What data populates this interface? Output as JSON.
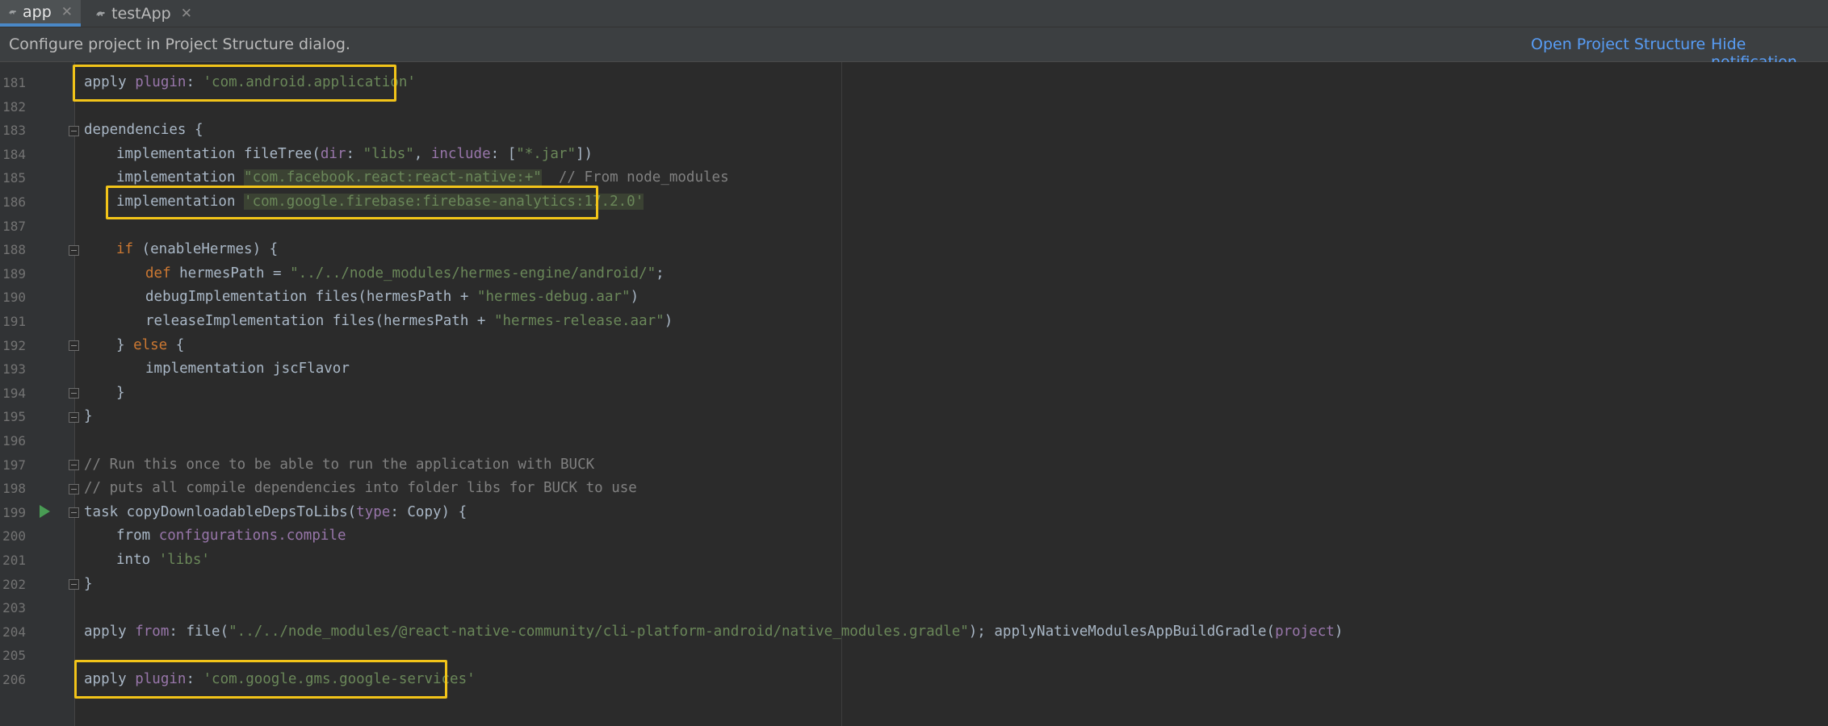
{
  "tabs": [
    {
      "label": "app",
      "icon": "gradle-icon",
      "active": true
    },
    {
      "label": "testApp",
      "icon": "gradle-icon",
      "active": false
    }
  ],
  "notification": {
    "message": "Configure project in Project Structure dialog.",
    "open_link": "Open Project Structure",
    "hide_link": "Hide notification"
  },
  "line_numbers": [
    "181",
    "182",
    "183",
    "184",
    "185",
    "186",
    "187",
    "188",
    "189",
    "190",
    "191",
    "192",
    "193",
    "194",
    "195",
    "196",
    "197",
    "198",
    "199",
    "200",
    "201",
    "202",
    "203",
    "204",
    "205",
    "206"
  ],
  "code": {
    "l181": [
      "apply ",
      "plugin",
      ": ",
      "'com.android.application'"
    ],
    "l183": [
      "dependencies {"
    ],
    "l184": [
      "implementation fileTree(",
      "dir",
      ": ",
      "\"libs\"",
      ", ",
      "include",
      ": [",
      "\"*.jar\"",
      "])"
    ],
    "l185": [
      "implementation ",
      "\"com.facebook.react:react-native:+\"",
      "  // From node_modules"
    ],
    "l186": [
      "implementation ",
      "'com.google.firebase:firebase-analytics:17.2.0'"
    ],
    "l188": [
      "if",
      " (enableHermes) {"
    ],
    "l189": [
      "def",
      " hermesPath = ",
      "\"../../node_modules/hermes-engine/android/\"",
      ";"
    ],
    "l190": [
      "debugImplementation files(hermesPath + ",
      "\"hermes-debug.aar\"",
      ")"
    ],
    "l191": [
      "releaseImplementation files(hermesPath + ",
      "\"hermes-release.aar\"",
      ")"
    ],
    "l192": [
      "} ",
      "else",
      " {"
    ],
    "l193": [
      "implementation jscFlavor"
    ],
    "l194": [
      "}"
    ],
    "l195": [
      "}"
    ],
    "l197": [
      "// Run this once to be able to run the application with BUCK"
    ],
    "l198": [
      "// puts all compile dependencies into folder libs for BUCK to use"
    ],
    "l199": [
      "task copyDownloadableDepsToLibs(",
      "type",
      ": Copy) {"
    ],
    "l200": [
      "from ",
      "configurations.compile"
    ],
    "l201": [
      "into ",
      "'libs'"
    ],
    "l202": [
      "}"
    ],
    "l204": [
      "apply ",
      "from",
      ": file(",
      "\"../../node_modules/@react-native-community/cli-platform-android/native_modules.gradle\"",
      "); applyNativeModulesAppBuildGradle(",
      "project",
      ")"
    ],
    "l206": [
      "apply ",
      "plugin",
      ": ",
      "'com.google.gms.google-services'"
    ]
  },
  "colors": {
    "background": "#2b2b2b",
    "gutter": "#313335",
    "keyword": "#cc7832",
    "string": "#6a8759",
    "comment": "#808080",
    "named_arg": "#9876aa",
    "highlight_box": "#f2c419",
    "link": "#589df6"
  }
}
